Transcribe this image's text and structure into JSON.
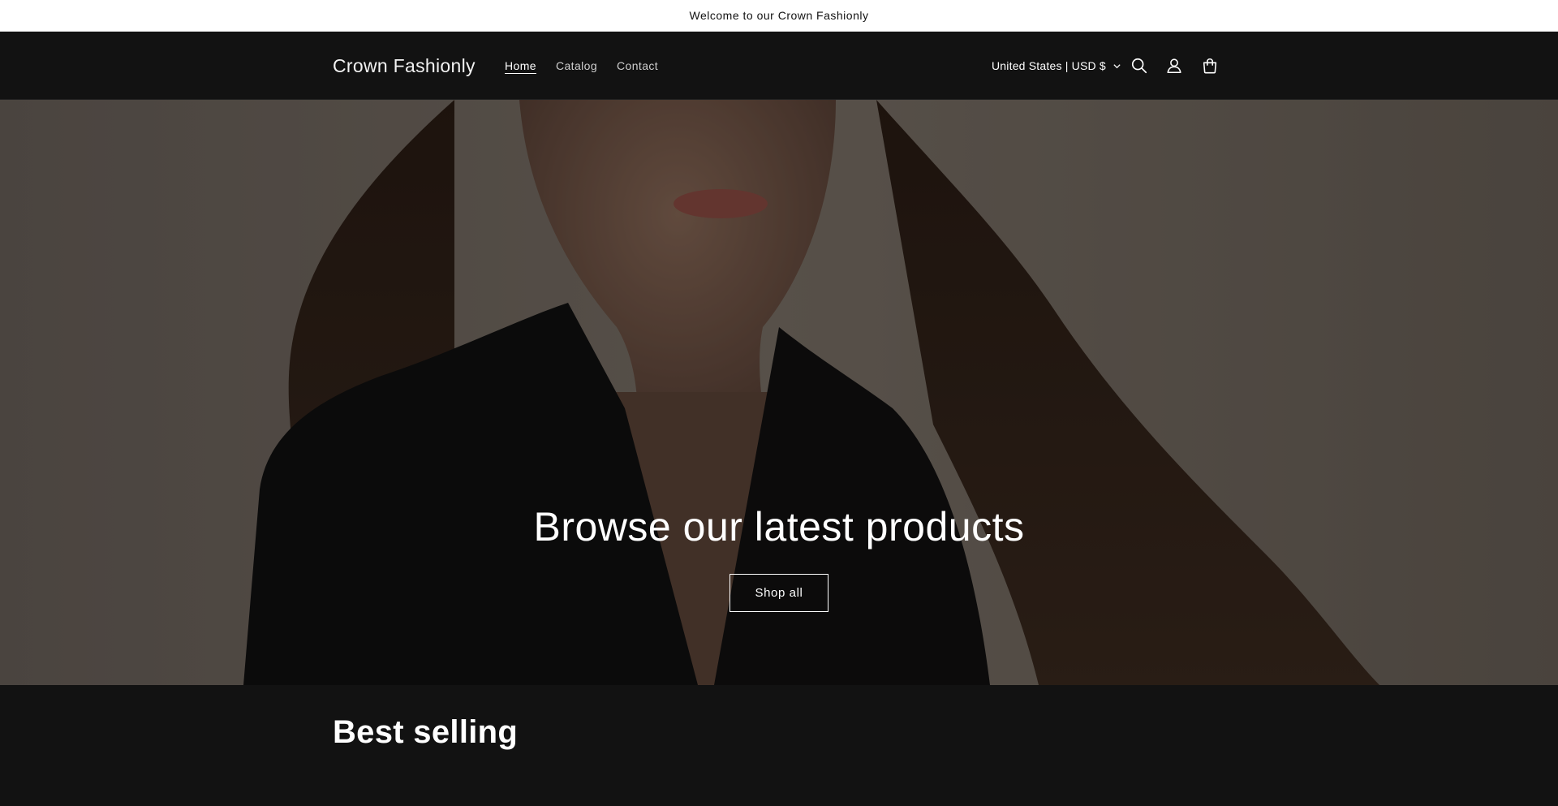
{
  "announcement": {
    "text": "Welcome to our Crown Fashionly"
  },
  "header": {
    "brand": "Crown Fashionly",
    "nav": [
      {
        "label": "Home",
        "active": true
      },
      {
        "label": "Catalog",
        "active": false
      },
      {
        "label": "Contact",
        "active": false
      }
    ],
    "locale": "United States | USD $",
    "icons": [
      "search-icon",
      "account-icon",
      "cart-icon"
    ]
  },
  "hero": {
    "title": "Browse our latest products",
    "button_label": "Shop all"
  },
  "best_selling": {
    "title": "Best selling"
  },
  "colors": {
    "background": "#121212",
    "announcement_bg": "#ffffff",
    "text_light": "#ffffff",
    "hero_backdrop": "#7a7067"
  }
}
